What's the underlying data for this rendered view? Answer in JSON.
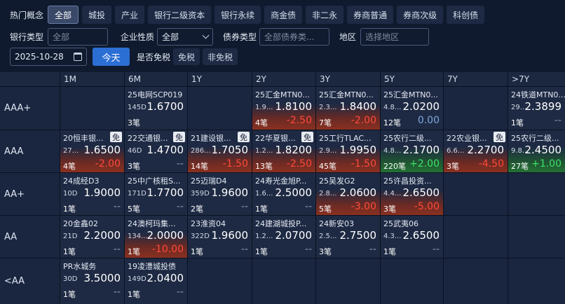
{
  "filters": {
    "hot_label": "热门概念",
    "hot_tags": [
      "全部",
      "城投",
      "产业",
      "银行二级资本",
      "银行永续",
      "商金债",
      "非二永",
      "券商普通",
      "券商次级",
      "科创债"
    ],
    "bank_type_label": "银行类型",
    "bank_type_value": "全部",
    "enterprise_label": "企业性质",
    "enterprise_value": "全部",
    "bond_type_label": "债券类型",
    "bond_type_placeholder": "全部债券类...",
    "region_label": "地区",
    "region_placeholder": "选择地区",
    "date_value": "2025-10-28",
    "today_label": "今天",
    "tax_label": "是否免税",
    "tax_options": [
      "免税",
      "非免税"
    ]
  },
  "grid": {
    "columns": [
      "1M",
      "6M",
      "1Y",
      "2Y",
      "3Y",
      "5Y",
      "7Y",
      ">7Y"
    ],
    "rows": [
      {
        "label": "AAA+",
        "cells": [
          null,
          {
            "name": "25电网SCP019",
            "days": "145D",
            "rate": "1.6700",
            "count": "3笔",
            "change": "",
            "tone": "none",
            "badge": ""
          },
          null,
          {
            "name": "25汇金MTN0...",
            "days": "1.9...",
            "rate": "1.8100",
            "count": "4笔",
            "change": "-2.50",
            "tone": "neg",
            "badge": ""
          },
          {
            "name": "25汇金MTN0...",
            "days": "2.3...",
            "rate": "1.8400",
            "count": "7笔",
            "change": "-2.00",
            "tone": "neg",
            "badge": ""
          },
          {
            "name": "25汇金MTN0...",
            "days": "4.8...",
            "rate": "2.0200",
            "count": "12笔",
            "change": "0.00",
            "tone": "zero",
            "badge": ""
          },
          null,
          {
            "name": "24铁道MTN0...",
            "days": "29...",
            "rate": "2.3899",
            "count": "1笔",
            "change": "--",
            "tone": "none",
            "badge": ""
          }
        ]
      },
      {
        "label": "AAA",
        "cells": [
          {
            "name": "20恒丰银...",
            "days": "27...",
            "rate": "1.6500",
            "count": "4笔",
            "change": "-2.00",
            "tone": "neg",
            "badge": "免"
          },
          {
            "name": "22交通银...",
            "days": "46D",
            "rate": "1.4700",
            "count": "3笔",
            "change": "--",
            "tone": "none",
            "badge": "免"
          },
          {
            "name": "21建设银...",
            "days": "286...",
            "rate": "1.7050",
            "count": "14笔",
            "change": "-1.50",
            "tone": "neg",
            "badge": "免"
          },
          {
            "name": "22华夏银...",
            "days": "1.2...",
            "rate": "1.8200",
            "count": "13笔",
            "change": "-2.50",
            "tone": "neg",
            "badge": "免"
          },
          {
            "name": "25工行TLAC...",
            "days": "2.9...",
            "rate": "1.9950",
            "count": "45笔",
            "change": "-1.50",
            "tone": "neg",
            "badge": ""
          },
          {
            "name": "25农行二级...",
            "days": "4.8...",
            "rate": "2.1700",
            "count": "220笔",
            "change": "+2.00",
            "tone": "pos",
            "badge": ""
          },
          {
            "name": "22农业银...",
            "days": "6.6...",
            "rate": "2.2700",
            "count": "3笔",
            "change": "-4.50",
            "tone": "neg",
            "badge": "免"
          },
          {
            "name": "25农行二级...",
            "days": "9.8...",
            "rate": "2.4500",
            "count": "27笔",
            "change": "+1.00",
            "tone": "pos",
            "badge": ""
          }
        ]
      },
      {
        "label": "AA+",
        "cells": [
          {
            "name": "24成经D3",
            "days": "10D",
            "rate": "1.9000",
            "count": "1笔",
            "change": "--",
            "tone": "none",
            "badge": ""
          },
          {
            "name": "25中广核租S...",
            "days": "171D",
            "rate": "1.7700",
            "count": "5笔",
            "change": "--",
            "tone": "none",
            "badge": ""
          },
          {
            "name": "25迈瑞D4",
            "days": "359D",
            "rate": "1.9600",
            "count": "2笔",
            "change": "--",
            "tone": "none",
            "badge": ""
          },
          {
            "name": "24寿光金旭P...",
            "days": "1.6...",
            "rate": "2.5000",
            "count": "1笔",
            "change": "--",
            "tone": "none",
            "badge": ""
          },
          {
            "name": "25吴发G2",
            "days": "2.8...",
            "rate": "2.0600",
            "count": "5笔",
            "change": "-3.00",
            "tone": "neg",
            "badge": ""
          },
          {
            "name": "25许昌投资...",
            "days": "4.4...",
            "rate": "2.6500",
            "count": "3笔",
            "change": "-5.00",
            "tone": "neg",
            "badge": ""
          },
          null,
          null
        ]
      },
      {
        "label": "AA",
        "cells": [
          {
            "name": "20金鑫02",
            "days": "21D",
            "rate": "2.2000",
            "count": "1笔",
            "change": "--",
            "tone": "none",
            "badge": ""
          },
          {
            "name": "24澳柯玛集...",
            "days": "134...",
            "rate": "2.0000",
            "count": "1笔",
            "change": "-10.00",
            "tone": "neg",
            "badge": ""
          },
          {
            "name": "23淮资04",
            "days": "322D",
            "rate": "1.9600",
            "count": "1笔",
            "change": "--",
            "tone": "none",
            "badge": ""
          },
          {
            "name": "24建湖城投P...",
            "days": "1.2...",
            "rate": "2.0700",
            "count": "1笔",
            "change": "--",
            "tone": "none",
            "badge": ""
          },
          {
            "name": "24新安03",
            "days": "2.5...",
            "rate": "2.7500",
            "count": "3笔",
            "change": "--",
            "tone": "none",
            "badge": ""
          },
          {
            "name": "25武夷06",
            "days": "4.3...",
            "rate": "2.6500",
            "count": "1笔",
            "change": "--",
            "tone": "none",
            "badge": ""
          },
          null,
          null
        ]
      },
      {
        "label": "<AA",
        "cells": [
          {
            "name": "PR水城务",
            "days": "30D",
            "rate": "3.5000",
            "count": "1笔",
            "change": "--",
            "tone": "none",
            "badge": ""
          },
          {
            "name": "19凌澧城投债",
            "days": "149D",
            "rate": "2.0400",
            "count": "1笔",
            "change": "--",
            "tone": "none",
            "badge": ""
          },
          null,
          null,
          null,
          null,
          null,
          null
        ]
      }
    ]
  }
}
